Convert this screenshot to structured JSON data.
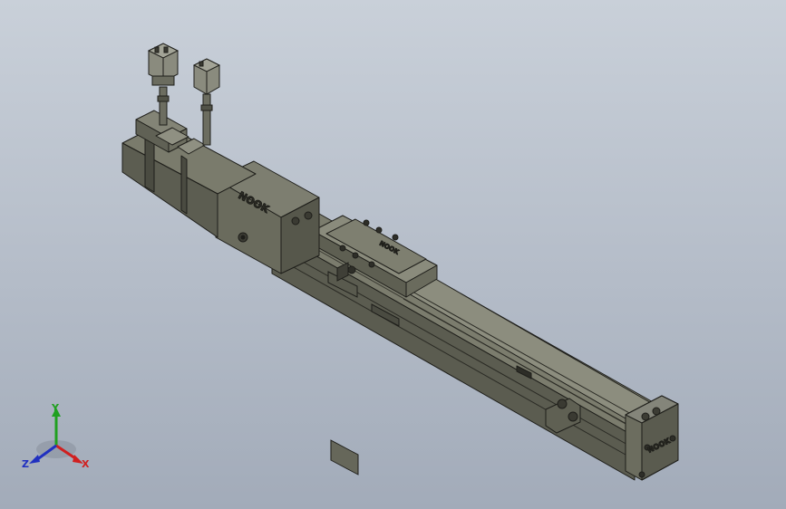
{
  "viewport": {
    "background_top": "#c9d0d9",
    "background_bottom": "#a2abb9"
  },
  "model": {
    "body_color": "#6f7062",
    "body_dark": "#4d4e43",
    "edge_color": "#1e1e1a",
    "motor_logo": "NOOK",
    "slider_logo": "NOOK",
    "end_cap_logo": "NOOK"
  },
  "triad": {
    "x_label": "X",
    "y_label": "Y",
    "z_label": "Z",
    "x_color": "#d02020",
    "y_color": "#20a020",
    "z_color": "#2030c0"
  }
}
